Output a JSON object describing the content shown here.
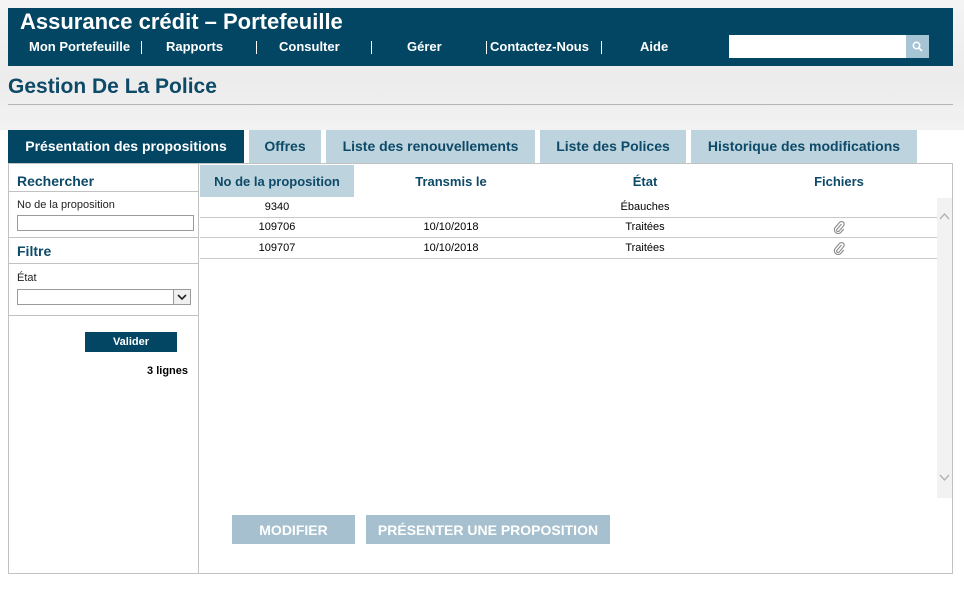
{
  "header": {
    "title": "Assurance crédit – Portefeuille",
    "nav": [
      "Mon Portefeuille",
      "Rapports",
      "Consulter",
      "Gérer",
      "Contactez-Nous",
      "Aide"
    ],
    "search_value": ""
  },
  "page": {
    "title": "Gestion De La Police"
  },
  "tabs": [
    {
      "label": "Présentation des propositions",
      "active": true
    },
    {
      "label": "Offres",
      "active": false
    },
    {
      "label": "Liste des renouvellements",
      "active": false
    },
    {
      "label": "Liste des Polices",
      "active": false
    },
    {
      "label": "Historique des modifications",
      "active": false
    }
  ],
  "search_panel": {
    "heading": "Rechercher",
    "field_label": "No de la proposition",
    "field_value": ""
  },
  "filter_panel": {
    "heading": "Filtre",
    "field_label": "État",
    "selected": ""
  },
  "submit_label": "Valider",
  "row_count": "3 lignes",
  "table": {
    "columns": [
      "No de la proposition",
      "Transmis le",
      "État",
      "Fichiers"
    ],
    "rows": [
      {
        "number": "9340",
        "sent": "",
        "state": "Ébauches",
        "has_file": false
      },
      {
        "number": "109706",
        "sent": "10/10/2018",
        "state": "Traitées",
        "has_file": true
      },
      {
        "number": "109707",
        "sent": "10/10/2018",
        "state": "Traitées",
        "has_file": true
      }
    ]
  },
  "actions": {
    "modify": "MODIFIER",
    "submit_proposal": "PRÉSENTER UNE PROPOSITION"
  },
  "colors": {
    "brand_dark": "#034664",
    "tab_light": "#bdd3dd",
    "title_text": "#0d4a68",
    "disabled_button": "#a6c0cf"
  }
}
